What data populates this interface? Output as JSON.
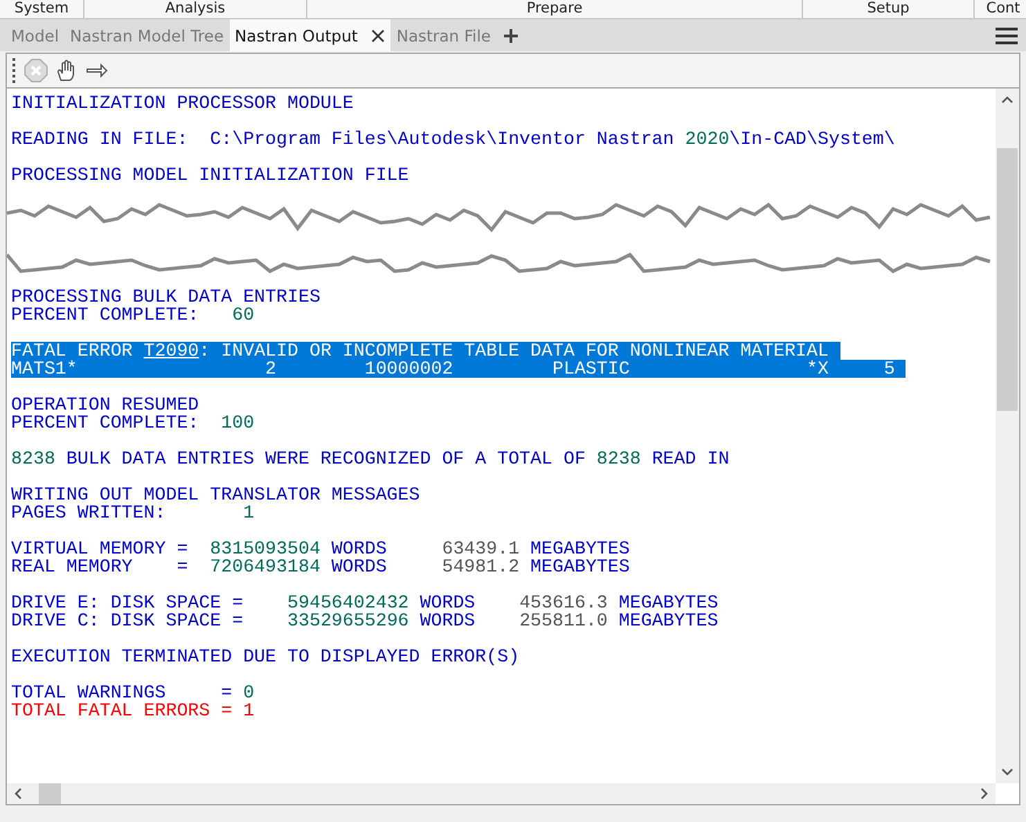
{
  "ribbon": [
    {
      "label": "System"
    },
    {
      "label": "Analysis"
    },
    {
      "label": "Prepare"
    },
    {
      "label": "Setup"
    },
    {
      "label": "Cont"
    }
  ],
  "tabs": [
    {
      "label": "Model",
      "selected": false,
      "closable": false
    },
    {
      "label": "Nastran Model Tree",
      "selected": false,
      "closable": false
    },
    {
      "label": "Nastran Output",
      "selected": true,
      "closable": true
    },
    {
      "label": "Nastran File",
      "selected": false,
      "closable": false
    }
  ],
  "toolbar": [
    {
      "kind": "stop",
      "disabled": true
    },
    {
      "kind": "hand",
      "disabled": false
    },
    {
      "kind": "arrow",
      "disabled": false
    }
  ],
  "console": [
    {
      "kind": "text",
      "lines": [
        {
          "selected": false,
          "segments": [
            {
              "kind": "word",
              "text": "INITIALIZATION PROCESSOR MODULE"
            }
          ]
        }
      ]
    },
    {
      "kind": "text",
      "lines": [
        {
          "selected": false,
          "segments": [
            {
              "kind": "word",
              "text": "READING IN FILE:  C:\\Program Files\\Autodesk\\Inventor Nastran "
            },
            {
              "kind": "number",
              "text": "2020"
            },
            {
              "kind": "word",
              "text": "\\In-CAD\\System\\"
            }
          ]
        }
      ]
    },
    {
      "kind": "text",
      "lines": [
        {
          "selected": false,
          "segments": [
            {
              "kind": "word",
              "text": "PROCESSING MODEL INITIALIZATION FILE"
            }
          ]
        }
      ]
    },
    {
      "kind": "tear"
    },
    {
      "kind": "text",
      "lines": [
        {
          "selected": false,
          "segments": [
            {
              "kind": "word",
              "text": "PROCESSING BULK DATA ENTRIES"
            }
          ]
        },
        {
          "selected": false,
          "segments": [
            {
              "kind": "word",
              "text": "PERCENT COMPLETE:   "
            },
            {
              "kind": "number",
              "text": "60"
            }
          ]
        }
      ]
    },
    {
      "kind": "text",
      "lines": [
        {
          "selected": true,
          "segments": [
            {
              "kind": "word",
              "text": "FATAL ERROR "
            },
            {
              "kind": "link",
              "text": "T2090"
            },
            {
              "kind": "word",
              "text": ": INVALID OR INCOMPLETE TABLE DATA FOR NONLINEAR MATERIAL"
            }
          ]
        },
        {
          "selected": true,
          "segments": [
            {
              "kind": "word",
              "text": "MATS1*                 2        10000002         PLASTIC                *X     5"
            }
          ]
        }
      ]
    },
    {
      "kind": "text",
      "lines": [
        {
          "selected": false,
          "segments": [
            {
              "kind": "word",
              "text": "OPERATION RESUMED"
            }
          ]
        },
        {
          "selected": false,
          "segments": [
            {
              "kind": "word",
              "text": "PERCENT COMPLETE:  "
            },
            {
              "kind": "number",
              "text": "100"
            }
          ]
        }
      ]
    },
    {
      "kind": "text",
      "lines": [
        {
          "selected": false,
          "segments": [
            {
              "kind": "number",
              "text": "8238"
            },
            {
              "kind": "word",
              "text": " BULK DATA ENTRIES WERE RECOGNIZED OF A TOTAL OF "
            },
            {
              "kind": "number",
              "text": "8238"
            },
            {
              "kind": "word",
              "text": " READ IN"
            }
          ]
        }
      ]
    },
    {
      "kind": "text",
      "lines": [
        {
          "selected": false,
          "segments": [
            {
              "kind": "word",
              "text": "WRITING OUT MODEL TRANSLATOR MESSAGES"
            }
          ]
        },
        {
          "selected": false,
          "segments": [
            {
              "kind": "word",
              "text": "PAGES WRITTEN:       "
            },
            {
              "kind": "number",
              "text": "1"
            }
          ]
        }
      ]
    },
    {
      "kind": "text",
      "lines": [
        {
          "selected": false,
          "segments": [
            {
              "kind": "word",
              "text": "VIRTUAL MEMORY =  "
            },
            {
              "kind": "number",
              "text": "8315093504"
            },
            {
              "kind": "word",
              "text": " WORDS     "
            },
            {
              "kind": "decimal",
              "text": "63439.1"
            },
            {
              "kind": "word",
              "text": " MEGABYTES"
            }
          ]
        },
        {
          "selected": false,
          "segments": [
            {
              "kind": "word",
              "text": "REAL MEMORY    =  "
            },
            {
              "kind": "number",
              "text": "7206493184"
            },
            {
              "kind": "word",
              "text": " WORDS     "
            },
            {
              "kind": "decimal",
              "text": "54981.2"
            },
            {
              "kind": "word",
              "text": " MEGABYTES"
            }
          ]
        }
      ]
    },
    {
      "kind": "text",
      "lines": [
        {
          "selected": false,
          "segments": [
            {
              "kind": "word",
              "text": "DRIVE E: DISK SPACE =    "
            },
            {
              "kind": "number",
              "text": "59456402432"
            },
            {
              "kind": "word",
              "text": " WORDS    "
            },
            {
              "kind": "decimal",
              "text": "453616.3"
            },
            {
              "kind": "word",
              "text": " MEGABYTES"
            }
          ]
        },
        {
          "selected": false,
          "segments": [
            {
              "kind": "word",
              "text": "DRIVE C: DISK SPACE =    "
            },
            {
              "kind": "number",
              "text": "33529655296"
            },
            {
              "kind": "word",
              "text": " WORDS    "
            },
            {
              "kind": "decimal",
              "text": "255811.0"
            },
            {
              "kind": "word",
              "text": " MEGABYTES"
            }
          ]
        }
      ]
    },
    {
      "kind": "text",
      "lines": [
        {
          "selected": false,
          "segments": [
            {
              "kind": "word",
              "text": "EXECUTION TERMINATED DUE TO DISPLAYED ERROR(S)"
            }
          ]
        }
      ]
    },
    {
      "kind": "text",
      "lines": [
        {
          "selected": false,
          "segments": [
            {
              "kind": "word",
              "text": "TOTAL WARNINGS     = "
            },
            {
              "kind": "number",
              "text": "0"
            }
          ]
        },
        {
          "selected": false,
          "segments": [
            {
              "kind": "error",
              "text": "TOTAL FATAL ERRORS = 1"
            }
          ]
        }
      ]
    }
  ]
}
